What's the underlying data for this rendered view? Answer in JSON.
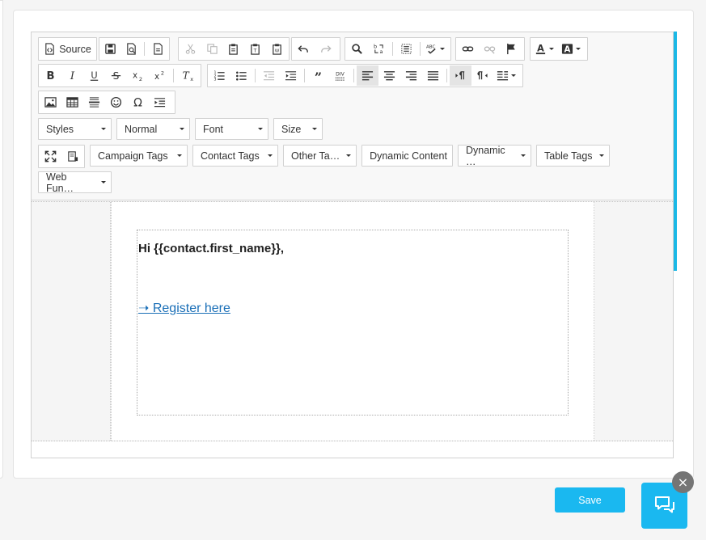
{
  "toolbar": {
    "source_label": "Source",
    "styles_label": "Styles",
    "format_label": "Normal",
    "font_label": "Font",
    "size_label": "Size",
    "campaign_tags_label": "Campaign Tags",
    "contact_tags_label": "Contact Tags",
    "other_tags_label": "Other Ta…",
    "dynamic_content_label": "Dynamic Content",
    "dynamic_label": "Dynamic …",
    "table_tags_label": "Table Tags",
    "web_functions_label": "Web Fun…",
    "formatting_buttons": [
      "bold",
      "italic",
      "underline",
      "strikethrough",
      "subscript",
      "superscript",
      "remove-format"
    ],
    "accent_color": "#1ab8e6"
  },
  "content": {
    "greeting": "Hi {{contact.first_name}},",
    "link_text": "➝ Register here",
    "link_color": "#1a6fb7"
  },
  "footer": {
    "save_label": "Save",
    "chat_close_label": "×",
    "button_color": "#1ab8f0"
  }
}
